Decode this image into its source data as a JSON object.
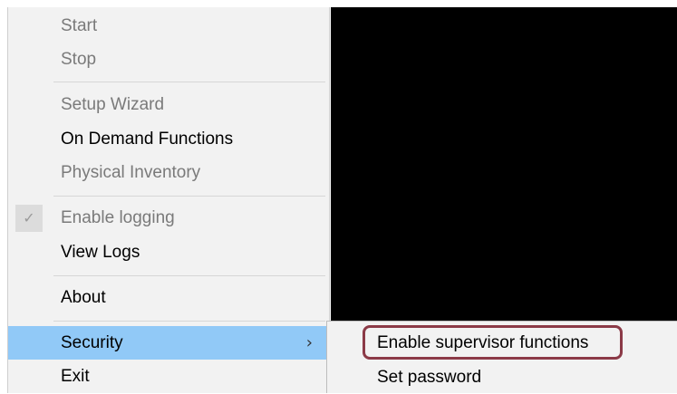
{
  "menu": {
    "items": [
      {
        "label": "Start",
        "disabled": true
      },
      {
        "label": "Stop",
        "disabled": true
      },
      {
        "label": "Setup Wizard",
        "disabled": true
      },
      {
        "label": "On Demand Functions",
        "disabled": false
      },
      {
        "label": "Physical Inventory",
        "disabled": true
      },
      {
        "label": "Enable logging",
        "disabled": true,
        "checked": true
      },
      {
        "label": "View Logs",
        "disabled": false
      },
      {
        "label": "About",
        "disabled": false
      },
      {
        "label": "Security",
        "disabled": false,
        "highlighted": true,
        "has_submenu": true
      },
      {
        "label": "Exit",
        "disabled": false
      }
    ],
    "check_glyph": "✓",
    "submenu_arrow": "›"
  },
  "submenu": {
    "items": [
      {
        "label": "Enable supervisor functions",
        "annotated": true
      },
      {
        "label": "Set password"
      }
    ]
  },
  "colors": {
    "highlight": "#91c9f7",
    "annotation": "#8b3a47",
    "menu_bg": "#f2f2f2",
    "disabled_text": "#7a7a7a"
  },
  "icons": {
    "check": "checkmark-icon",
    "submenu_arrow": "chevron-right-icon"
  }
}
